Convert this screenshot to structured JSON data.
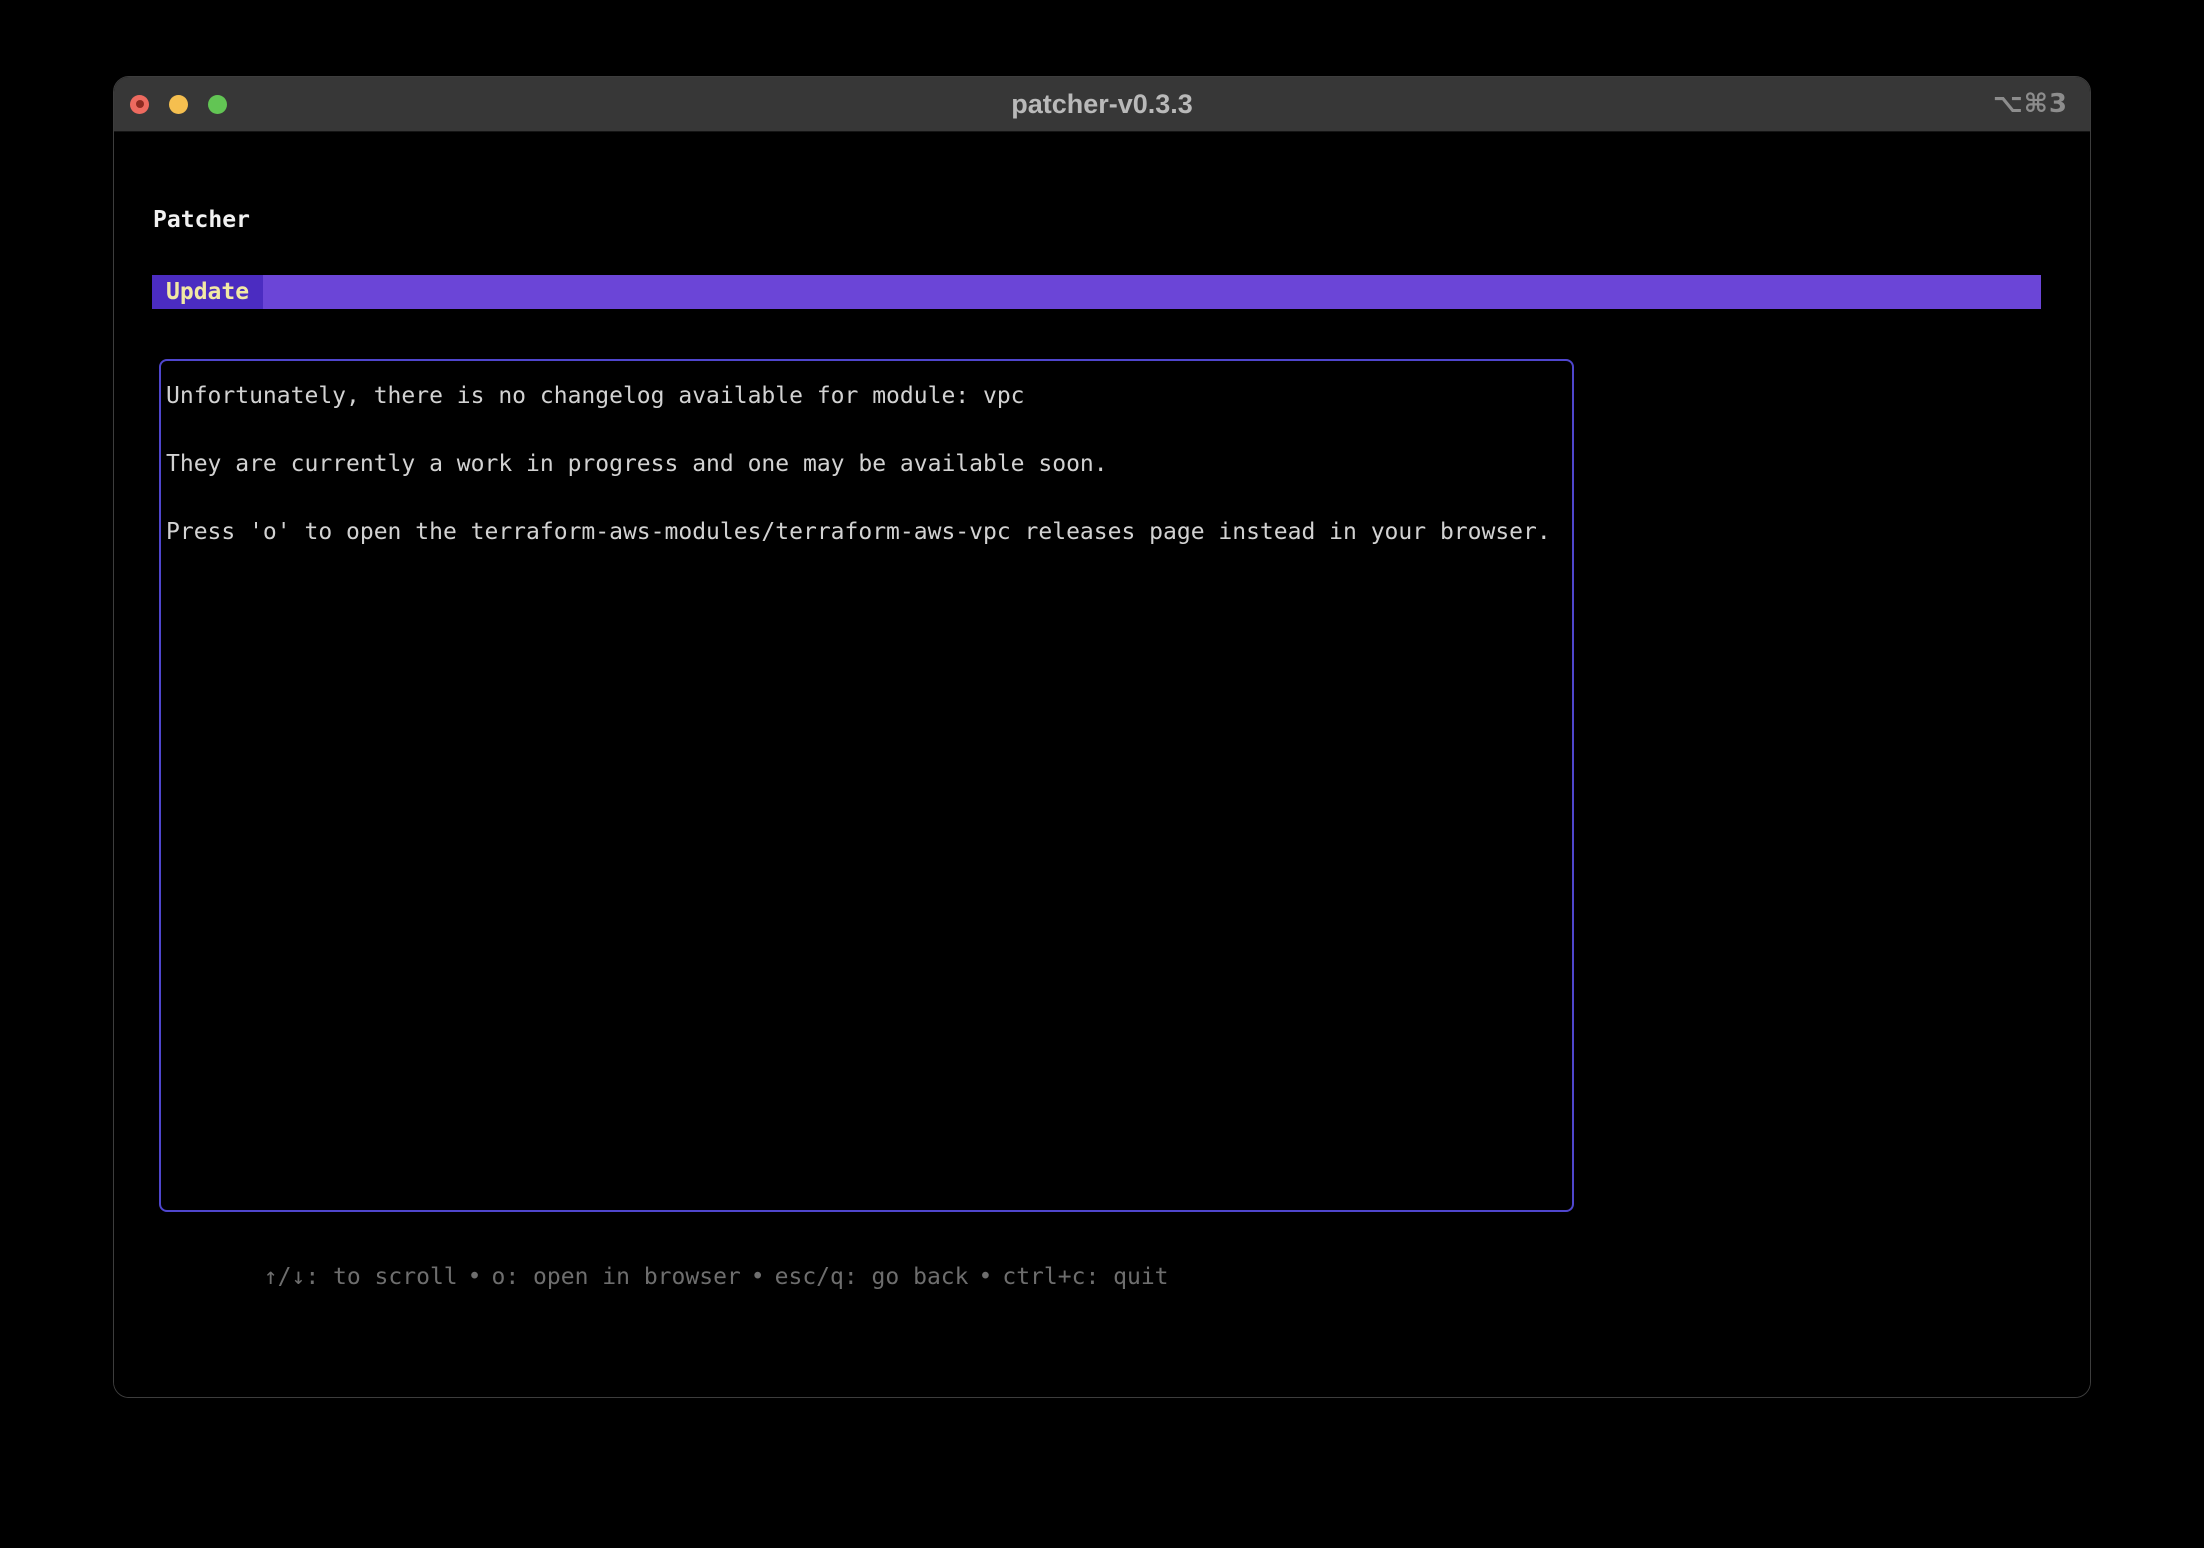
{
  "window": {
    "title": "patcher-v0.3.3",
    "shortcut": "⌥⌘3",
    "traffic_lights": [
      "close",
      "minimize",
      "zoom"
    ],
    "titlebar_color": "#373737"
  },
  "app": {
    "heading": "Patcher",
    "tab_bar": {
      "active_tab": "Update",
      "bar_color": "#6b45d7",
      "active_tab_color": "#4b2cc1",
      "active_tab_text_color": "#f2e9a4"
    },
    "changelog_panel": {
      "module": "vpc",
      "border_color": "#4f46cd",
      "lines": [
        "Unfortunately, there is no changelog available for module: vpc",
        "",
        "They are currently a work in progress and one may be available soon.",
        "",
        "Press 'o' to open the terraform-aws-modules/terraform-aws-vpc releases page instead in your browser."
      ]
    },
    "help_bar": {
      "separator": "•",
      "items": [
        "↑/↓: to scroll",
        "o: open in browser",
        "esc/q: go back",
        "ctrl+c: quit"
      ]
    }
  }
}
